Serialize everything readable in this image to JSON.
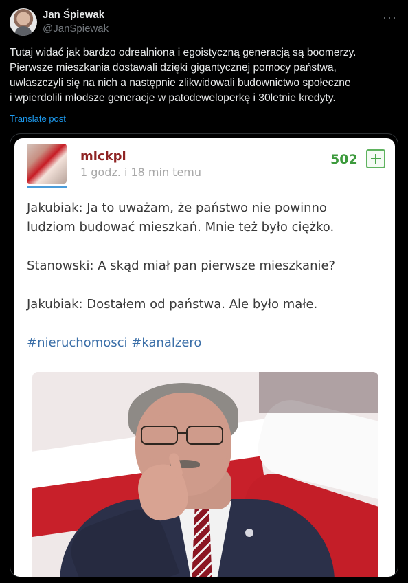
{
  "tweet": {
    "author_name": "Jan Śpiewak",
    "author_handle": "@JanSpiewak",
    "more_label": "···",
    "text_lines": [
      "Tutaj widać jak bardzo odrealniona i egoistyczną generacją są boomerzy.",
      "Pierwsze mieszkania dostawali dzięki gigantycznej pomocy państwa,",
      "uwłaszczyli się na nich a następnie zlikwidowali budownictwo społeczne",
      "i wpierdolili młodsze generacje w patodeweloperkę i 30letnie kredyty."
    ],
    "translate_label": "Translate post"
  },
  "embedded_post": {
    "username": "mickpl",
    "time_ago": "1 godz. i 18 min temu",
    "vote_count": "502",
    "lines": [
      "Jakubiak: Ja to uważam, że państwo nie powinno",
      "ludziom budować mieszkań. Mnie też było ciężko.",
      "Stanowski: A skąd miał pan pierwsze mieszkanie?",
      "Jakubiak: Dostałem od państwa. Ale było małe."
    ],
    "tags": [
      "#nieruchomosci",
      "#kanalzero"
    ]
  },
  "colors": {
    "background": "#000000",
    "link": "#1d9bf0",
    "username": "#8f2424",
    "vote": "#3c9a3c",
    "tag": "#3b6fa8"
  }
}
